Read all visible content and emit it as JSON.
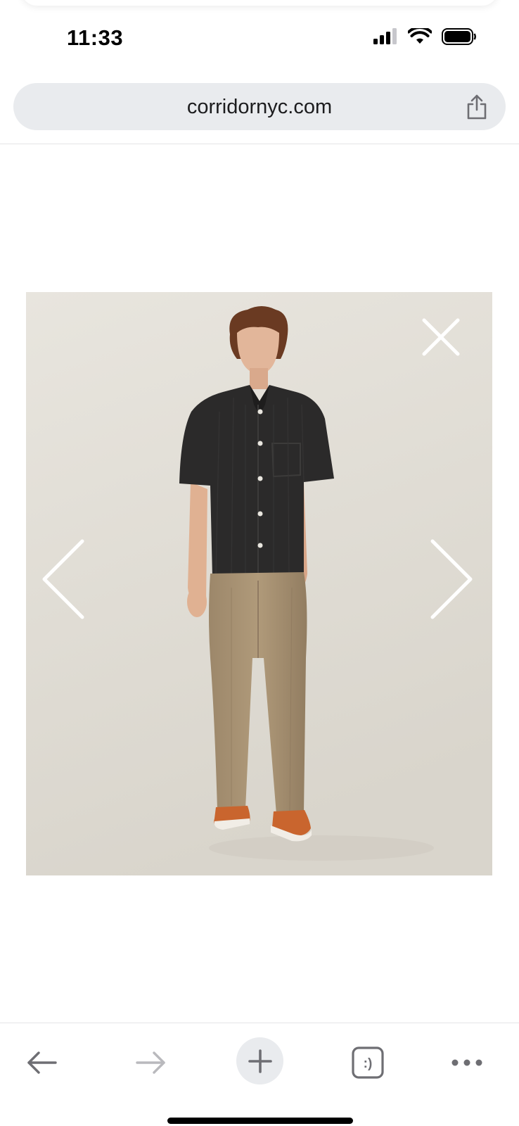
{
  "status_bar": {
    "time": "11:33"
  },
  "address_bar": {
    "url": "corridornyc.com",
    "share_icon": "share-icon"
  },
  "lightbox": {
    "close_icon": "close-icon",
    "prev_icon": "chevron-left-icon",
    "next_icon": "chevron-right-icon",
    "photo_subject": "model in black short-sleeve shirt and tan trousers"
  },
  "toolbar": {
    "back_icon": "arrow-left-icon",
    "forward_icon": "arrow-right-icon",
    "new_tab_icon": "plus-icon",
    "tabs_icon": "tabs-icon",
    "tabs_label": ":)",
    "more_icon": "more-icon"
  },
  "colors": {
    "address_bar_bg": "#e9ebee",
    "backdrop": "#e3e0d8",
    "shirt": "#2b2a2a",
    "trousers": "#a08a6b",
    "shoes": "#c9652e"
  }
}
